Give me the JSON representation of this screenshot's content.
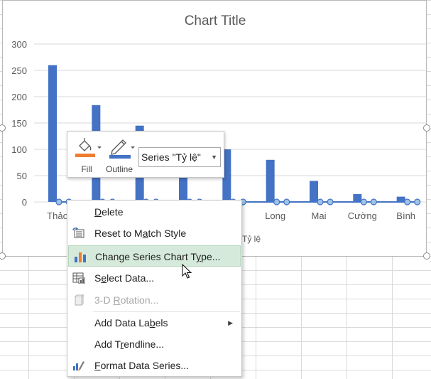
{
  "chart": {
    "title": "Chart Title",
    "legend_text": "Tỷ lệ",
    "colors": {
      "bar": "#4472c4",
      "line": "#4472c4",
      "marker_fill": "#9dc3e6",
      "grid": "#d9d9d9"
    }
  },
  "chart_data": {
    "type": "bar",
    "title": "Chart Title",
    "categories": [
      "Thảo",
      "",
      "",
      "",
      "",
      "Long",
      "Mai",
      "Cường",
      "Bình"
    ],
    "series": [
      {
        "values": [
          260,
          184,
          145,
          110,
          100,
          80,
          40,
          15,
          10
        ]
      },
      {
        "name": "Tỷ lệ",
        "type": "line",
        "values": [
          0,
          0,
          0,
          0,
          0,
          0,
          0,
          0,
          0
        ]
      }
    ],
    "y_ticks": [
      "300",
      "250",
      "200",
      "150",
      "100",
      "50",
      "0"
    ],
    "ylim": [
      0,
      300
    ],
    "grid": true,
    "legend_position": "bottom"
  },
  "toolbar": {
    "fill_label": "Fill",
    "outline_label": "Outline",
    "series_selector_value": "Series \"Tỷ lệ\"",
    "fill_color": "#ed7d31",
    "outline_color": "#4472c4"
  },
  "context_menu": {
    "delete_pre": "",
    "delete_ul": "D",
    "delete_post": "elete",
    "reset_pre": "Reset to M",
    "reset_ul": "a",
    "reset_post": "tch Style",
    "change_pre": "Change Series Chart T",
    "change_ul": "y",
    "change_post": "pe...",
    "select_pre": "S",
    "select_ul": "e",
    "select_post": "lect Data...",
    "rotation_pre": "3-D ",
    "rotation_ul": "R",
    "rotation_post": "otation...",
    "labels_pre": "Add Data La",
    "labels_ul": "b",
    "labels_post": "els",
    "trend_pre": "Add T",
    "trend_ul": "r",
    "trend_post": "endline...",
    "format_pre": "",
    "format_ul": "F",
    "format_post": "ormat Data Series..."
  }
}
